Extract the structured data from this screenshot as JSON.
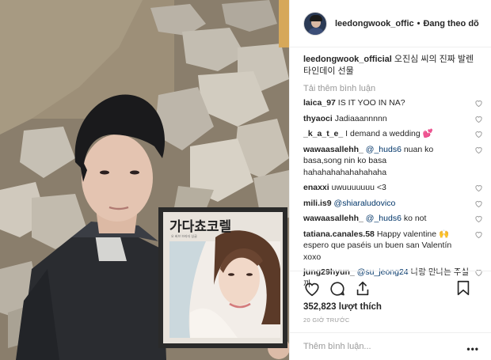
{
  "header": {
    "username": "leedongwook_offic",
    "separator": "•",
    "follow_status": "Đang theo dõ"
  },
  "caption": {
    "username": "leedongwook_official",
    "text": "오진심 씨의 진짜 발렌타인데이 선물"
  },
  "load_more_label": "Tải thêm bình luận",
  "photo": {
    "album_title": "가다쵸코렐",
    "album_subtitle": "오 버브 브라더 싱글"
  },
  "comments": [
    {
      "username": "laica_97",
      "text": "IS IT YOO IN NA?"
    },
    {
      "username": "thyaoci",
      "text": "Jadiaaannnnn"
    },
    {
      "username": "_k_a_t_e_",
      "text": "I demand a wedding",
      "emoji": "💕"
    },
    {
      "username": "wawaasallehh_",
      "mention": "@_huds6",
      "text": "nuan ko basa,song nin ko basa hahahahahahahahaha"
    },
    {
      "username": "enaxxi",
      "text": "uwuuuuuuu <3"
    },
    {
      "username": "mili.is9",
      "mention": "@shiaraludovico",
      "text": ""
    },
    {
      "username": "wawaasallehh_",
      "mention": "@_huds6",
      "text": "ko not"
    },
    {
      "username": "tatiana.canales.58",
      "text_before": "Happy valentine",
      "emoji": "🙌",
      "text": "espero que paséis un buen san Valentín xoxo"
    },
    {
      "username": "jung29hyun_",
      "mention": "@su_jeong24",
      "text": "나랑 만나는 주실까"
    }
  ],
  "actions": {
    "likes": "352,823 lượt thích",
    "time": "20 GIỜ TRƯỚC"
  },
  "add_comment": {
    "placeholder": "Thêm bình luận...",
    "more": "•••"
  },
  "icons": [
    "heart-icon",
    "comment-icon",
    "share-icon",
    "bookmark-icon",
    "more-options-icon"
  ],
  "colors": {
    "mention": "#003569",
    "muted": "#999999",
    "text": "#262626"
  }
}
